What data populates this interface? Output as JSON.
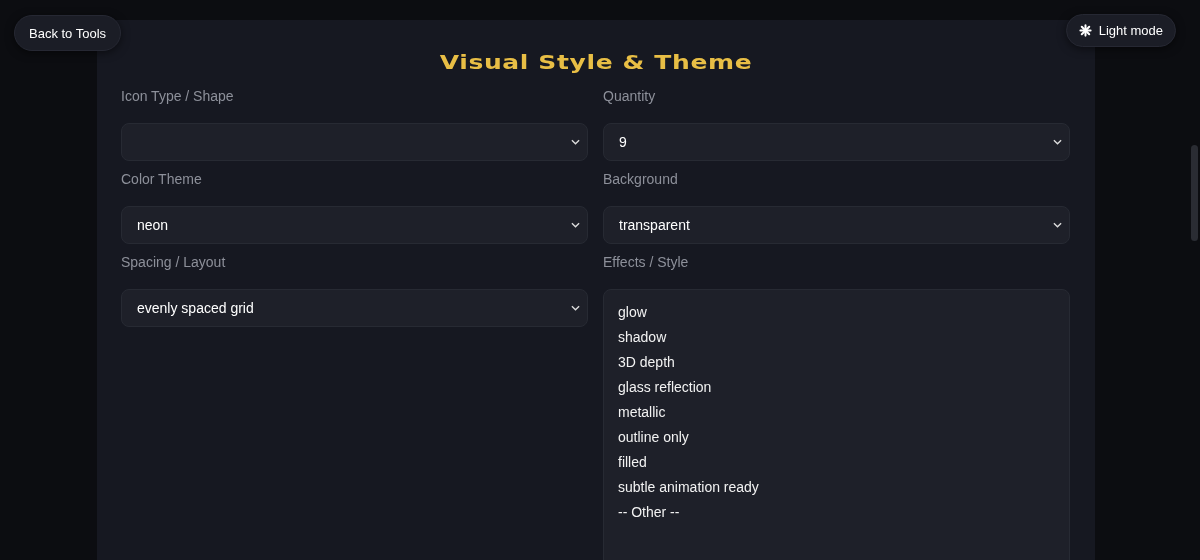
{
  "back_button": {
    "label": "Back to Tools"
  },
  "theme_toggle": {
    "label": "Light mode"
  },
  "section": {
    "title": "Visual Style & Theme"
  },
  "fields": [
    {
      "kind": "select",
      "label": "Icon Type / Shape"
    },
    {
      "kind": "select",
      "label": "Quantity",
      "value": "9"
    },
    {
      "kind": "select",
      "label": "Color Theme",
      "value": "neon"
    },
    {
      "kind": "select",
      "label": "Background",
      "value": "transparent"
    },
    {
      "kind": "select",
      "label": "Spacing / Layout",
      "value": "evenly spaced grid"
    },
    {
      "kind": "listbox",
      "label": "Effects / Style",
      "options": [
        {
          "label": "glow",
          "selected": false
        },
        {
          "label": "shadow",
          "selected": false
        },
        {
          "label": "3D depth",
          "selected": false
        },
        {
          "label": "glass reflection",
          "selected": false
        },
        {
          "label": "metallic",
          "selected": false
        },
        {
          "label": "outline only",
          "selected": false
        },
        {
          "label": "filled",
          "selected": false
        },
        {
          "label": "subtle animation ready",
          "selected": false
        },
        {
          "label": "-- Other --",
          "selected": false
        }
      ]
    }
  ]
}
